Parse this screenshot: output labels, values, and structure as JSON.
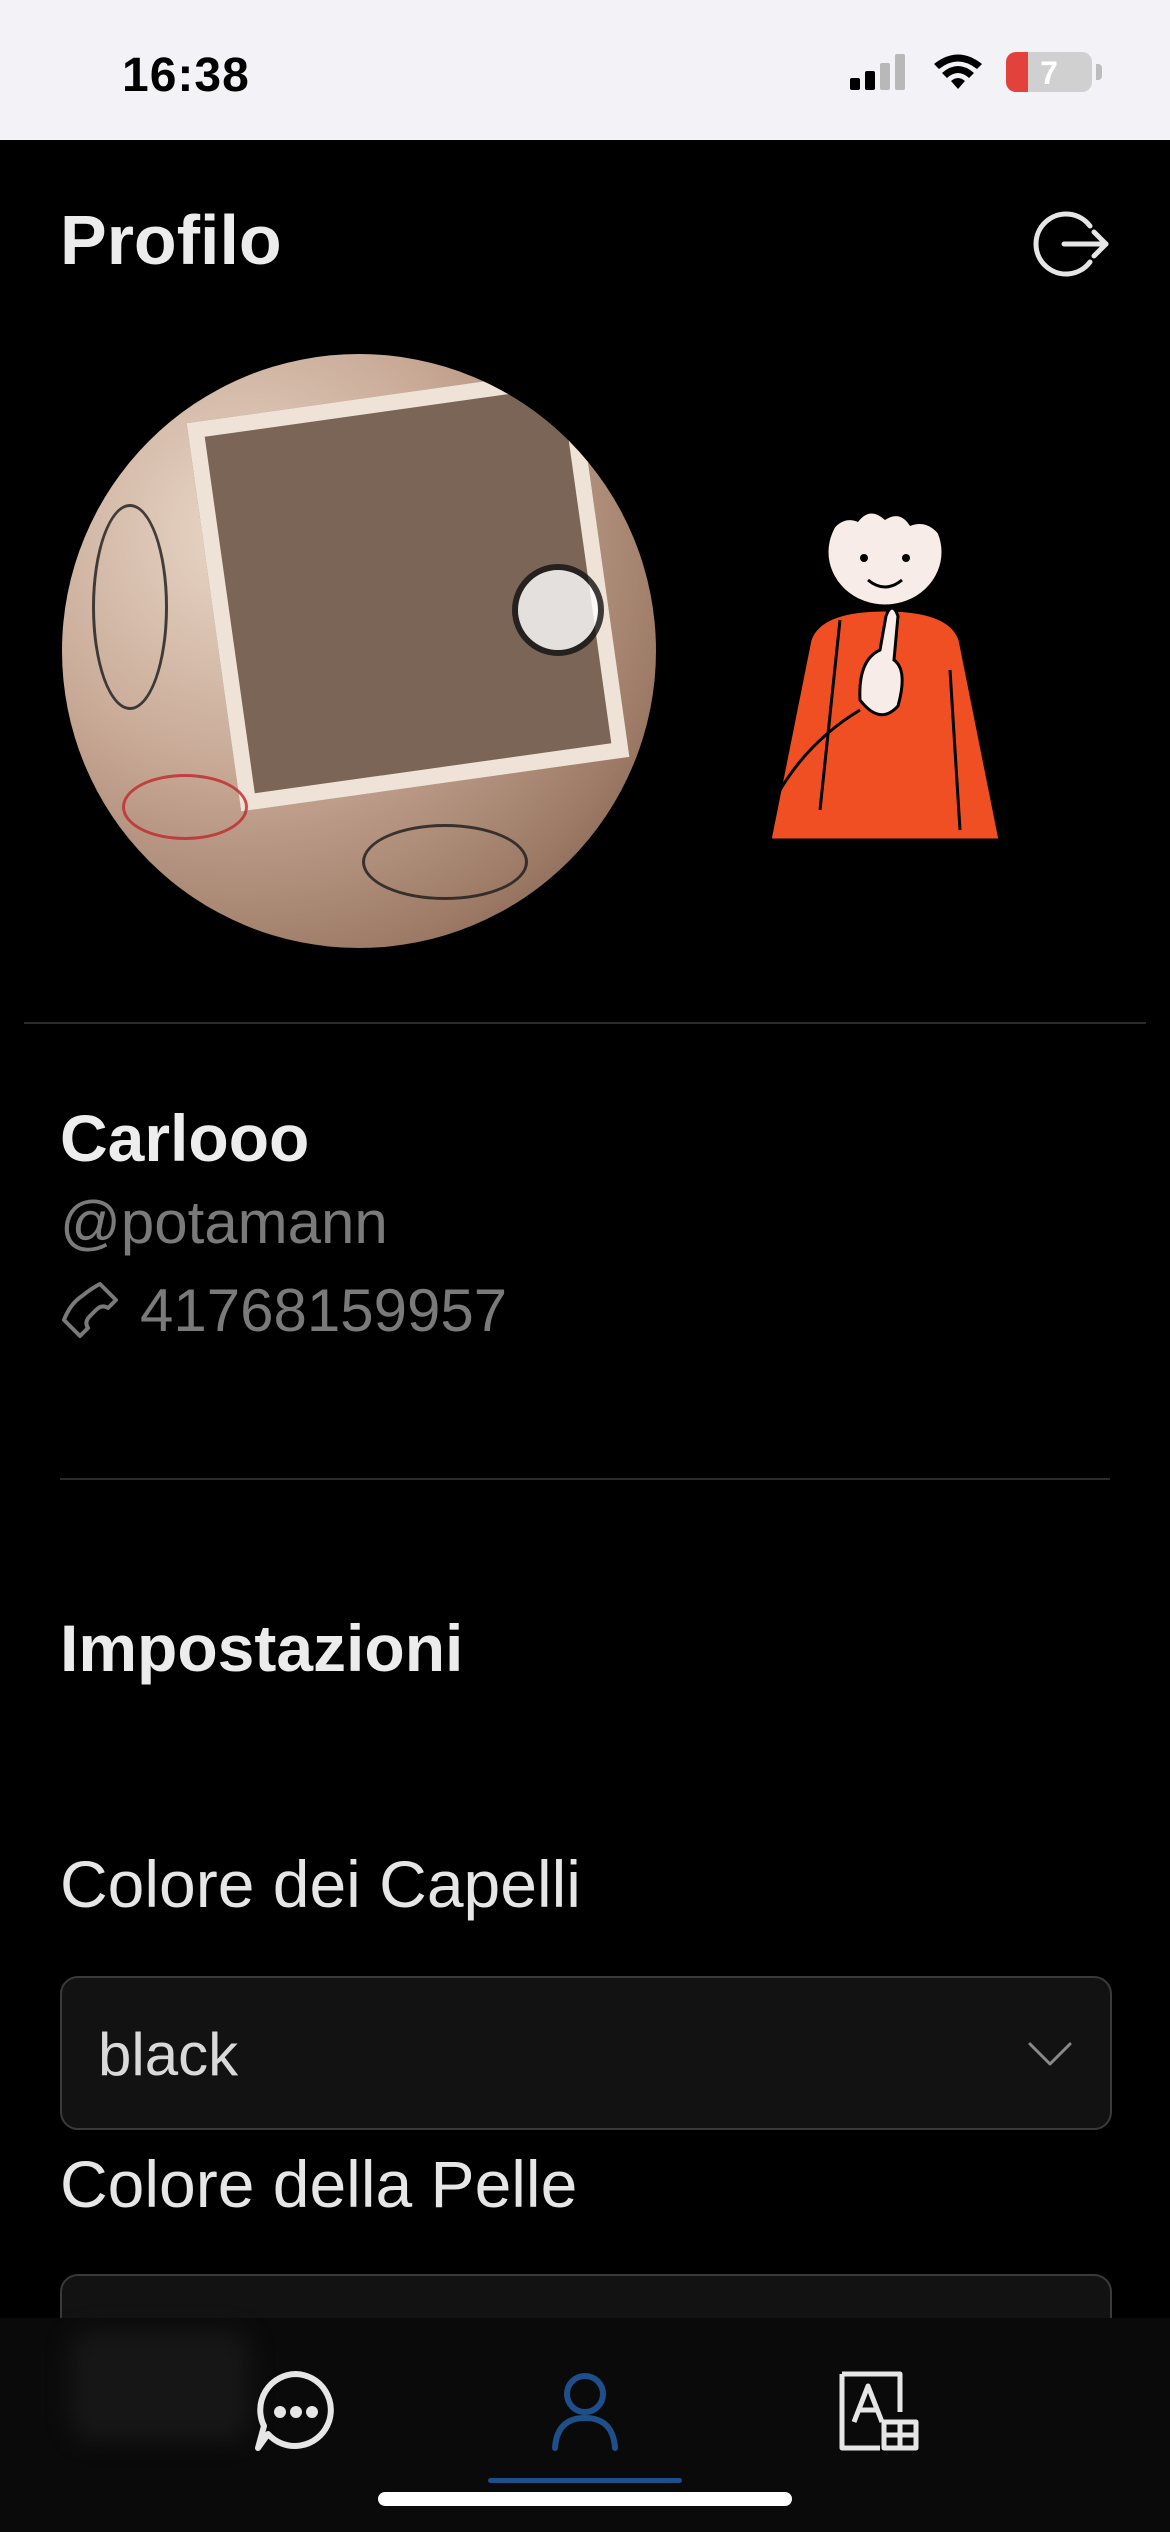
{
  "status_bar": {
    "time": "16:38",
    "battery_level": "7",
    "icons": [
      "cellular-signal-icon",
      "wifi-icon",
      "battery-icon"
    ]
  },
  "header": {
    "title": "Profilo",
    "logout_icon": "logout-icon"
  },
  "profile": {
    "display_name": "Carlooo",
    "username": "@potamann",
    "phone": "41768159957",
    "phone_icon": "phone-icon"
  },
  "settings": {
    "title": "Impostazioni",
    "hair_color": {
      "label": "Colore dei Capelli",
      "value": "black"
    },
    "skin_color": {
      "label": "Colore della Pelle"
    }
  },
  "tab_bar": {
    "tabs": [
      {
        "icon": "chat-icon",
        "active": false
      },
      {
        "icon": "profile-icon",
        "active": true
      },
      {
        "icon": "symbol-translate-icon",
        "active": false
      }
    ],
    "accent_color": "#1f4f8a"
  },
  "colors": {
    "background": "#000000",
    "avatar_shirt": "#f04e23"
  }
}
